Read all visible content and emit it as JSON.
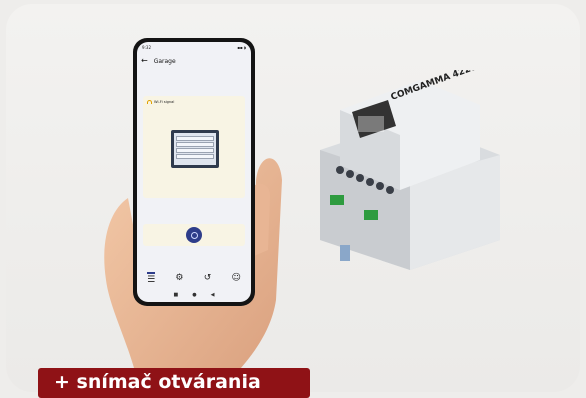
{
  "phone": {
    "status_time": "9:32",
    "status_icons": "▪▪ ◗",
    "title": "Garage",
    "wifi_label": "Wi-Fi signal",
    "nav_icons": [
      "sliders-icon",
      "gear-icon",
      "history-icon",
      "users-icon"
    ],
    "sys_nav": [
      "■",
      "●",
      "◀"
    ]
  },
  "device": {
    "brand_label": "COMGAMMA 4220"
  },
  "banner": {
    "text": "+ snímač otvárania"
  }
}
